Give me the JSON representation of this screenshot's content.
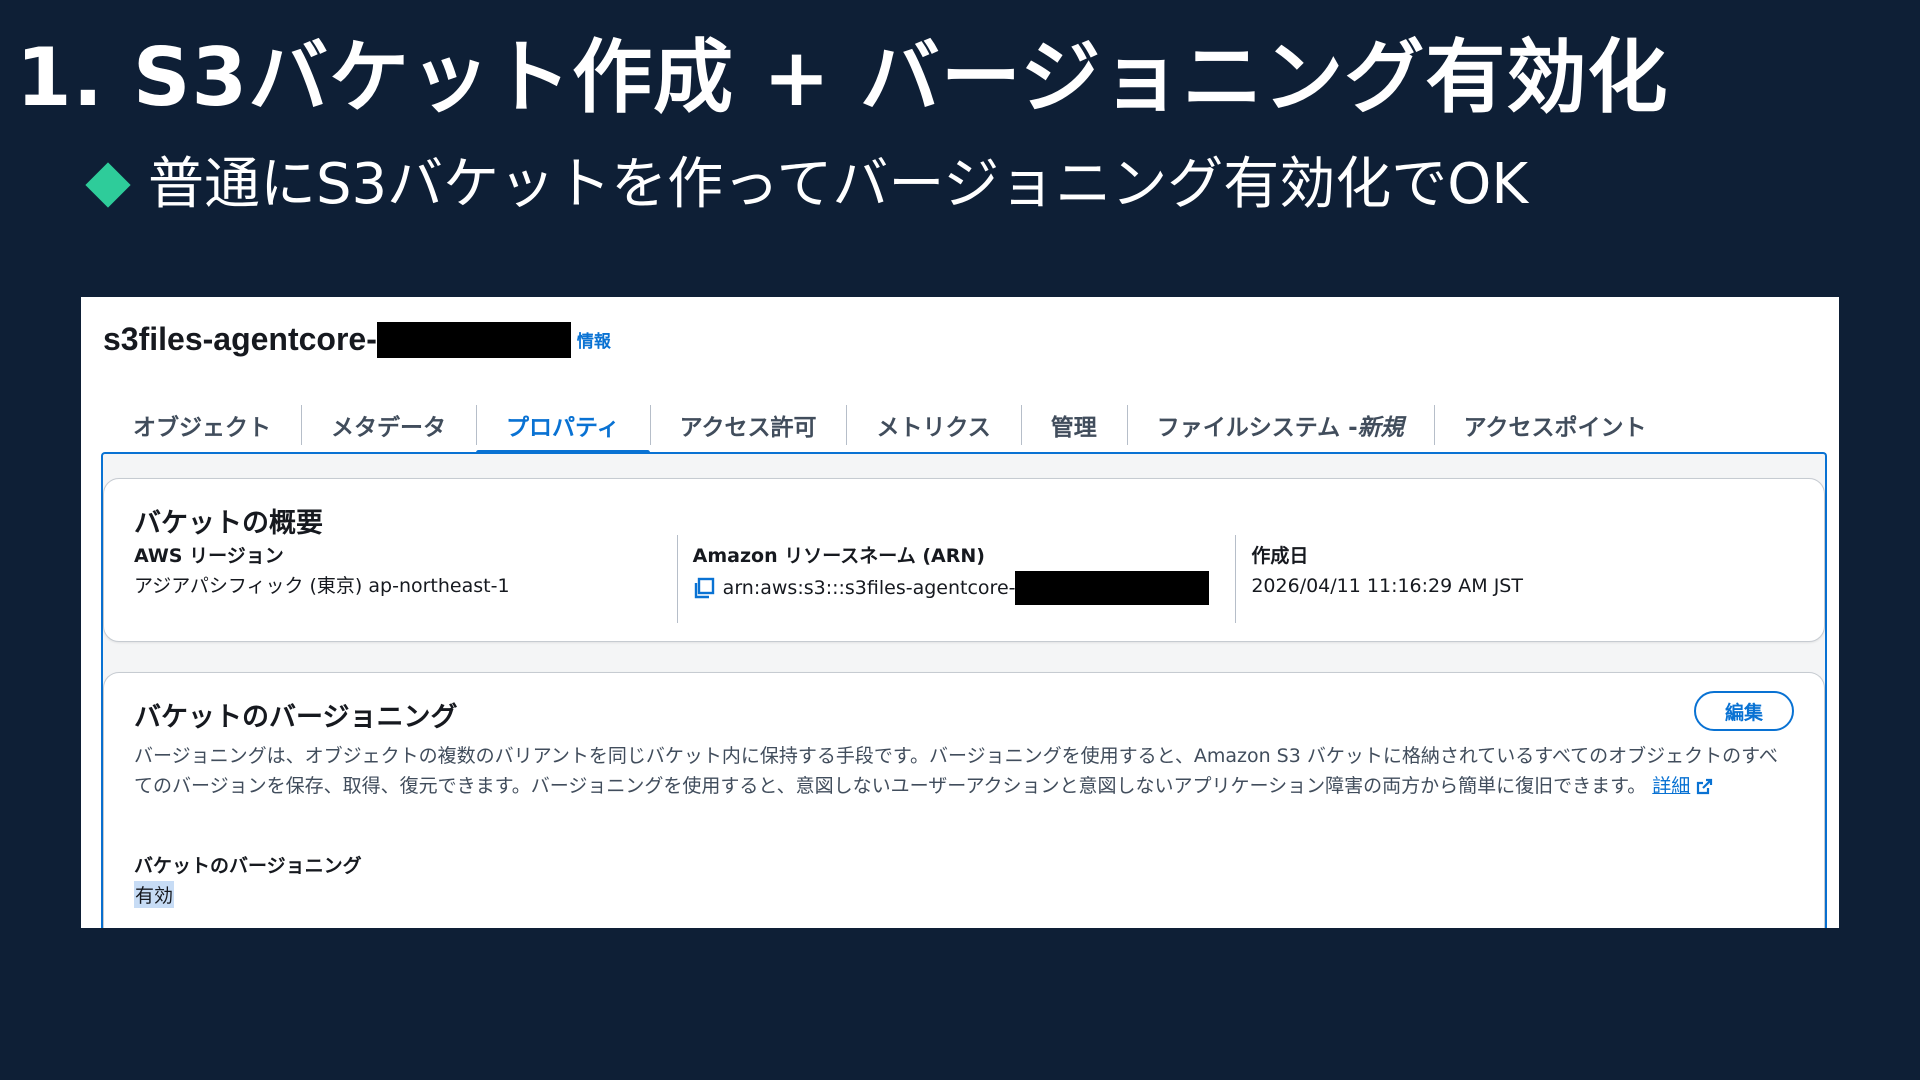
{
  "slide": {
    "title": "1. S3バケット作成 + バージョニング有効化",
    "bullet": "普通にS3バケットを作ってバージョニング有効化でOK",
    "accent_color": "#2ecc9a",
    "background_color": "#0e1f36"
  },
  "console": {
    "bucket_name": "s3files-agentcore-",
    "info_link": "情報",
    "tabs": [
      {
        "label": "オブジェクト"
      },
      {
        "label": "メタデータ"
      },
      {
        "label": "プロパティ"
      },
      {
        "label": "アクセス許可"
      },
      {
        "label": "メトリクス"
      },
      {
        "label": "管理"
      },
      {
        "label": "ファイルシステム - ",
        "suffix": "新規"
      },
      {
        "label": "アクセスポイント"
      }
    ],
    "active_tab": "プロパティ",
    "overview": {
      "title": "バケットの概要",
      "region_label": "AWS リージョン",
      "region_value": "アジアパシフィック (東京) ap-northeast-1",
      "arn_label": "Amazon リソースネーム (ARN)",
      "arn_value": "arn:aws:s3:::s3files-agentcore-",
      "created_label": "作成日",
      "created_value": "2026/04/11 11:16:29 AM JST"
    },
    "versioning": {
      "title": "バケットのバージョニング",
      "edit_button": "編集",
      "description": "バージョニングは、オブジェクトの複数のバリアントを同じバケット内に保持する手段です。バージョニングを使用すると、Amazon S3 バケットに格納されているすべてのオブジェクトのすべてのバージョンを保存、取得、復元できます。バージョニングを使用すると、意図しないユーザーアクションと意図しないアプリケーション障害の両方から簡単に復旧できます。",
      "detail_link": "詳細",
      "status_label": "バケットのバージョニング",
      "status_value": "有効"
    },
    "link_color": "#0972d3"
  }
}
